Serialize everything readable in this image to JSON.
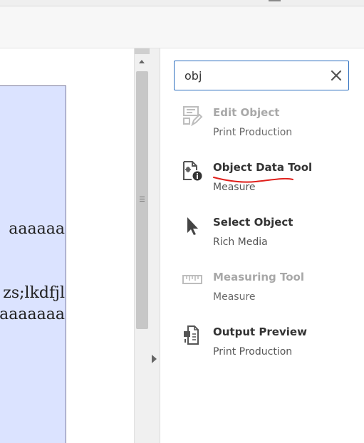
{
  "document": {
    "lines": [
      "aaaaaa",
      "zs;lkdfjl",
      "aaaaaaa"
    ]
  },
  "search": {
    "value": "obj",
    "placeholder": ""
  },
  "results": [
    {
      "title": "Edit Object",
      "category": "Print Production",
      "enabled": false,
      "icon": "edit-object-icon"
    },
    {
      "title": "Object Data Tool",
      "category": "Measure",
      "enabled": true,
      "icon": "object-data-tool-icon"
    },
    {
      "title": "Select Object",
      "category": "Rich Media",
      "enabled": true,
      "icon": "select-object-icon"
    },
    {
      "title": "Measuring Tool",
      "category": "Measure",
      "enabled": false,
      "icon": "measuring-tool-icon"
    },
    {
      "title": "Output Preview",
      "category": "Print Production",
      "enabled": true,
      "icon": "output-preview-icon"
    }
  ],
  "colors": {
    "accent_border": "#2d6fbf",
    "annotation_stroke": "#e0201c",
    "doc_fill": "#dbe3ff"
  }
}
